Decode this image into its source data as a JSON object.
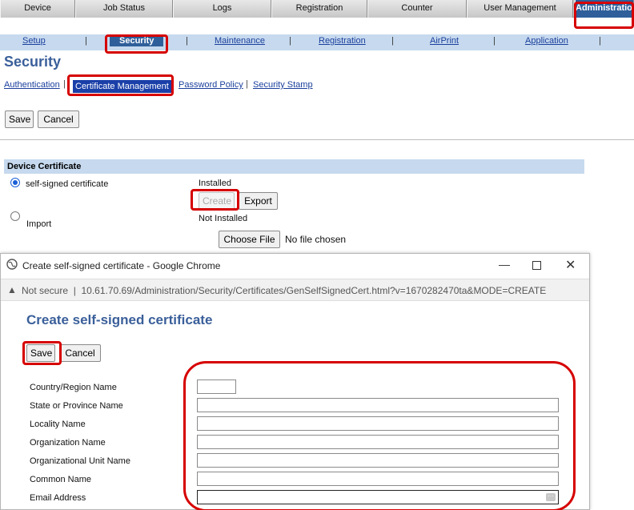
{
  "top_tabs": [
    "Device",
    "Job Status",
    "Logs",
    "Registration",
    "Counter",
    "User Management",
    "Administration"
  ],
  "sub_nav": [
    "Setup",
    "Security",
    "Maintenance",
    "Registration",
    "AirPrint",
    "Application"
  ],
  "page": {
    "title": "Security",
    "security_links": [
      "Authentication",
      "Certificate Management",
      "Password Policy",
      "Security Stamp"
    ],
    "save_label": "Save",
    "cancel_label": "Cancel"
  },
  "device_certificate": {
    "header": "Device Certificate",
    "options": [
      {
        "label": "self-signed certificate",
        "status": "Installed",
        "checked": true
      },
      {
        "label": "Import",
        "status": "Not Installed",
        "checked": false
      }
    ],
    "create_label": "Create",
    "export_label": "Export",
    "choose_file_label": "Choose File",
    "no_file_text": "No file chosen"
  },
  "popup": {
    "window_title": "Create self-signed certificate - Google Chrome",
    "not_secure": "Not secure",
    "url": "10.61.70.69/Administration/Security/Certificates/GenSelfSignedCert.html?v=1670282470ta&MODE=CREATE",
    "heading": "Create self-signed certificate",
    "save_label": "Save",
    "cancel_label": "Cancel",
    "fields": [
      {
        "label": "Country/Region Name",
        "value": ""
      },
      {
        "label": "State or Province Name",
        "value": ""
      },
      {
        "label": "Locality Name",
        "value": ""
      },
      {
        "label": "Organization Name",
        "value": ""
      },
      {
        "label": "Organizational Unit Name",
        "value": ""
      },
      {
        "label": "Common Name",
        "value": ""
      },
      {
        "label": "Email Address",
        "value": ""
      }
    ]
  },
  "colors": {
    "highlight": "#d60000",
    "nav_active": "#2e5f9a",
    "heading": "#3a5f9a",
    "subnav_bg": "#c6d9ee"
  },
  "icons": [
    "globe-icon",
    "minimize-icon",
    "maximize-icon",
    "close-icon",
    "warning-icon",
    "radio-icon"
  ]
}
